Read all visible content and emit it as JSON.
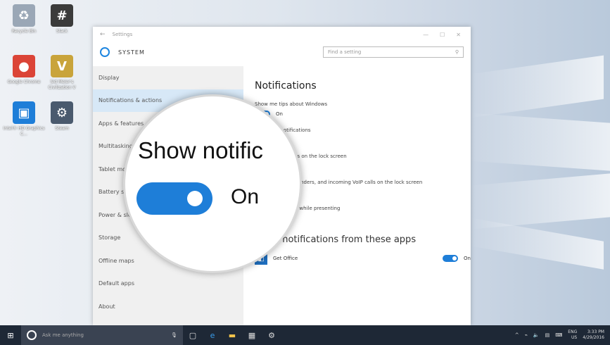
{
  "desktop": {
    "icons": [
      {
        "label": "Recycle Bin",
        "glyph": "♻",
        "color": "#9aa7b6"
      },
      {
        "label": "Slack",
        "glyph": "#",
        "color": "#3b3b3b"
      },
      {
        "label": "Google Chrome",
        "glyph": "●",
        "color": "#db4437"
      },
      {
        "label": "Sid Meier's Civilization V",
        "glyph": "V",
        "color": "#c9a43b"
      },
      {
        "label": "Intel® HD Graphics C...",
        "glyph": "▣",
        "color": "#1e7ed8"
      },
      {
        "label": "Steam",
        "glyph": "⚙",
        "color": "#4a5a6e"
      }
    ]
  },
  "window": {
    "title": "Settings",
    "back_glyph": "←",
    "controls": [
      "—",
      "☐",
      "✕"
    ],
    "section": "SYSTEM",
    "search_placeholder": "Find a setting",
    "nav": [
      {
        "label": "Display",
        "selected": false
      },
      {
        "label": "Notifications & actions",
        "selected": true
      },
      {
        "label": "Apps & features",
        "selected": false
      },
      {
        "label": "Multitasking",
        "selected": false
      },
      {
        "label": "Tablet mode",
        "selected": false
      },
      {
        "label": "Battery saver",
        "selected": false
      },
      {
        "label": "Power & sleep",
        "selected": false
      },
      {
        "label": "Storage",
        "selected": false
      },
      {
        "label": "Offline maps",
        "selected": false
      },
      {
        "label": "Default apps",
        "selected": false
      },
      {
        "label": "About",
        "selected": false
      }
    ],
    "content": {
      "heading": "Notifications",
      "settings": [
        {
          "label": "Show me tips about Windows",
          "state": "On",
          "on": true
        },
        {
          "label": "Show app notifications",
          "state": "On",
          "on": true
        },
        {
          "label": "Show notifications on the lock screen",
          "state": "On",
          "on": true
        },
        {
          "label": "Show alarms, reminders, and incoming VoIP calls on the lock screen",
          "state": "On",
          "on": true
        },
        {
          "label": "Hide notifications while presenting",
          "state": "Off",
          "on": false
        }
      ],
      "apps_heading": "Show notifications from these apps",
      "apps": [
        {
          "name": "Get Office",
          "state": "On",
          "on": true
        }
      ]
    }
  },
  "magnifier": {
    "text": "Show notific",
    "state": "On"
  },
  "taskbar": {
    "search_placeholder": "Ask me anything",
    "lang": "ENG",
    "region": "US",
    "time": "3:33 PM",
    "date": "4/29/2016"
  }
}
